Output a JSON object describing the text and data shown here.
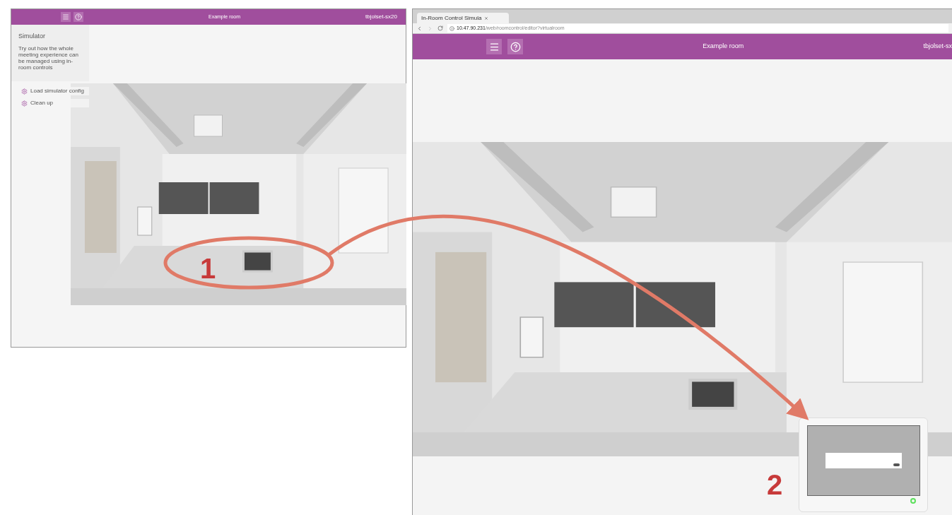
{
  "left_screen": {
    "header": {
      "title": "Example room",
      "user": "tbjolset-sx20"
    },
    "sidebar": {
      "title": "Simulator",
      "description": "Try out how the whole meeting experience can be managed using in-room controls",
      "items": [
        {
          "label": "Load simulator config"
        },
        {
          "label": "Clean up"
        }
      ]
    }
  },
  "right_screen": {
    "browser": {
      "tab_title": "In-Room Control Simula",
      "address_host": "10.47.90.231",
      "address_path": "/web/roomcontrol/editor?virtualroom"
    },
    "header": {
      "title": "Example room",
      "user": "tbjolset-sx"
    }
  },
  "annotations": [
    {
      "label": "1"
    },
    {
      "label": "2"
    }
  ]
}
